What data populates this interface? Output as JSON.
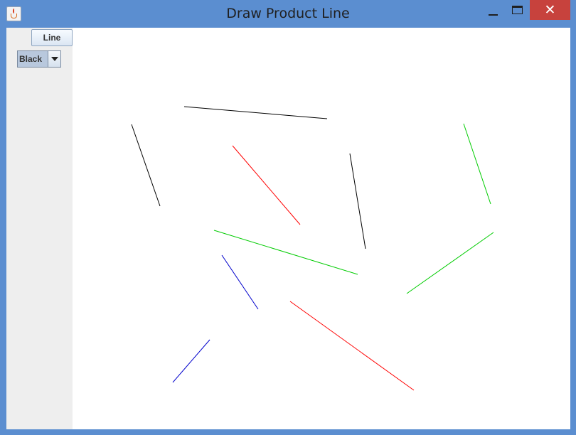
{
  "window": {
    "title": "Draw Product Line",
    "close_glyph": "✕"
  },
  "toolbar": {
    "line_button_label": "Line",
    "color_select": {
      "selected": "Black"
    }
  },
  "drawing": {
    "lines": [
      {
        "color": "#000000"
      },
      {
        "color": "#000000"
      },
      {
        "color": "#ff0000"
      },
      {
        "color": "#000000"
      },
      {
        "color": "#00cc00"
      },
      {
        "color": "#00cc00"
      },
      {
        "color": "#00cc00"
      },
      {
        "color": "#0000cc"
      },
      {
        "color": "#ff0000"
      },
      {
        "color": "#0000cc"
      }
    ]
  },
  "colors": {
    "titlebar": "#5b8ed0",
    "close_button": "#c7423d",
    "canvas": "#ffffff",
    "panel": "#eeeeee"
  }
}
